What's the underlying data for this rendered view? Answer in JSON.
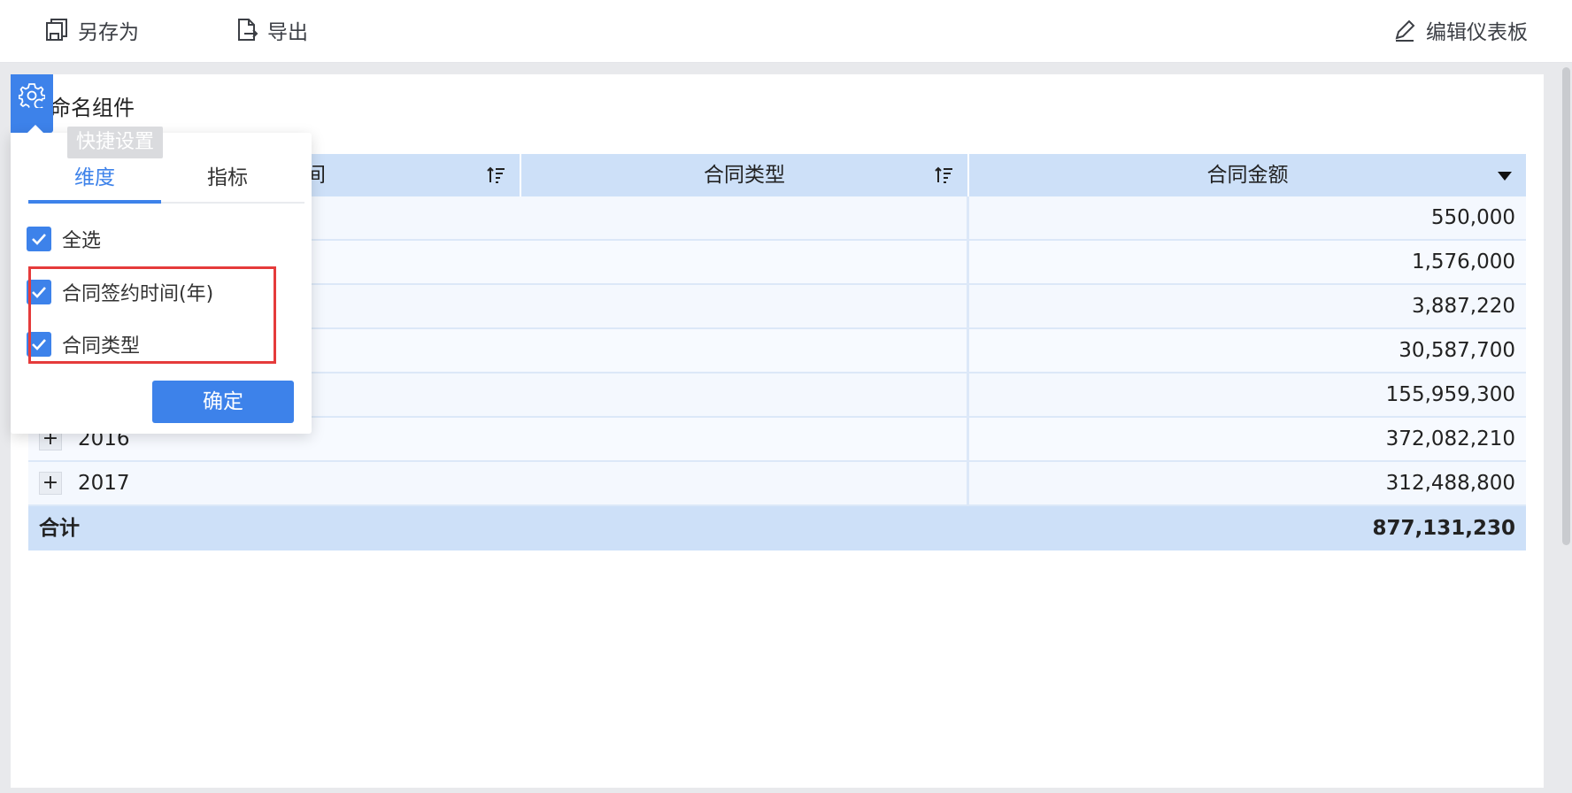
{
  "toolbar": {
    "save_as_label": "另存为",
    "export_label": "导出",
    "edit_dashboard_label": "编辑仪表板"
  },
  "widget": {
    "title": "命名组件"
  },
  "quick_settings": {
    "tooltip": "快捷设置",
    "tabs": [
      "维度",
      "指标"
    ],
    "active_tab": "维度",
    "options": [
      {
        "label": "全选",
        "checked": true
      },
      {
        "label": "合同签约时间(年)",
        "checked": true
      },
      {
        "label": "合同类型",
        "checked": true
      }
    ],
    "confirm_label": "确定"
  },
  "table": {
    "headers": {
      "col1_partial": "时间",
      "col2": "合同类型",
      "col3": "合同金额"
    },
    "rows": [
      {
        "year": "",
        "amount": "550,000"
      },
      {
        "year": "",
        "amount": "1,576,000"
      },
      {
        "year": "",
        "amount": "3,887,220"
      },
      {
        "year": "",
        "amount": "30,587,700"
      },
      {
        "year": "",
        "amount": "155,959,300"
      },
      {
        "year": "2016",
        "amount": "372,082,210"
      },
      {
        "year": "2017",
        "amount": "312,488,800"
      }
    ],
    "total": {
      "label": "合计",
      "amount": "877,131,230"
    }
  },
  "colors": {
    "accent": "#3d82ea",
    "header_bg": "#cde0f8",
    "highlight": "#e53b3b"
  }
}
